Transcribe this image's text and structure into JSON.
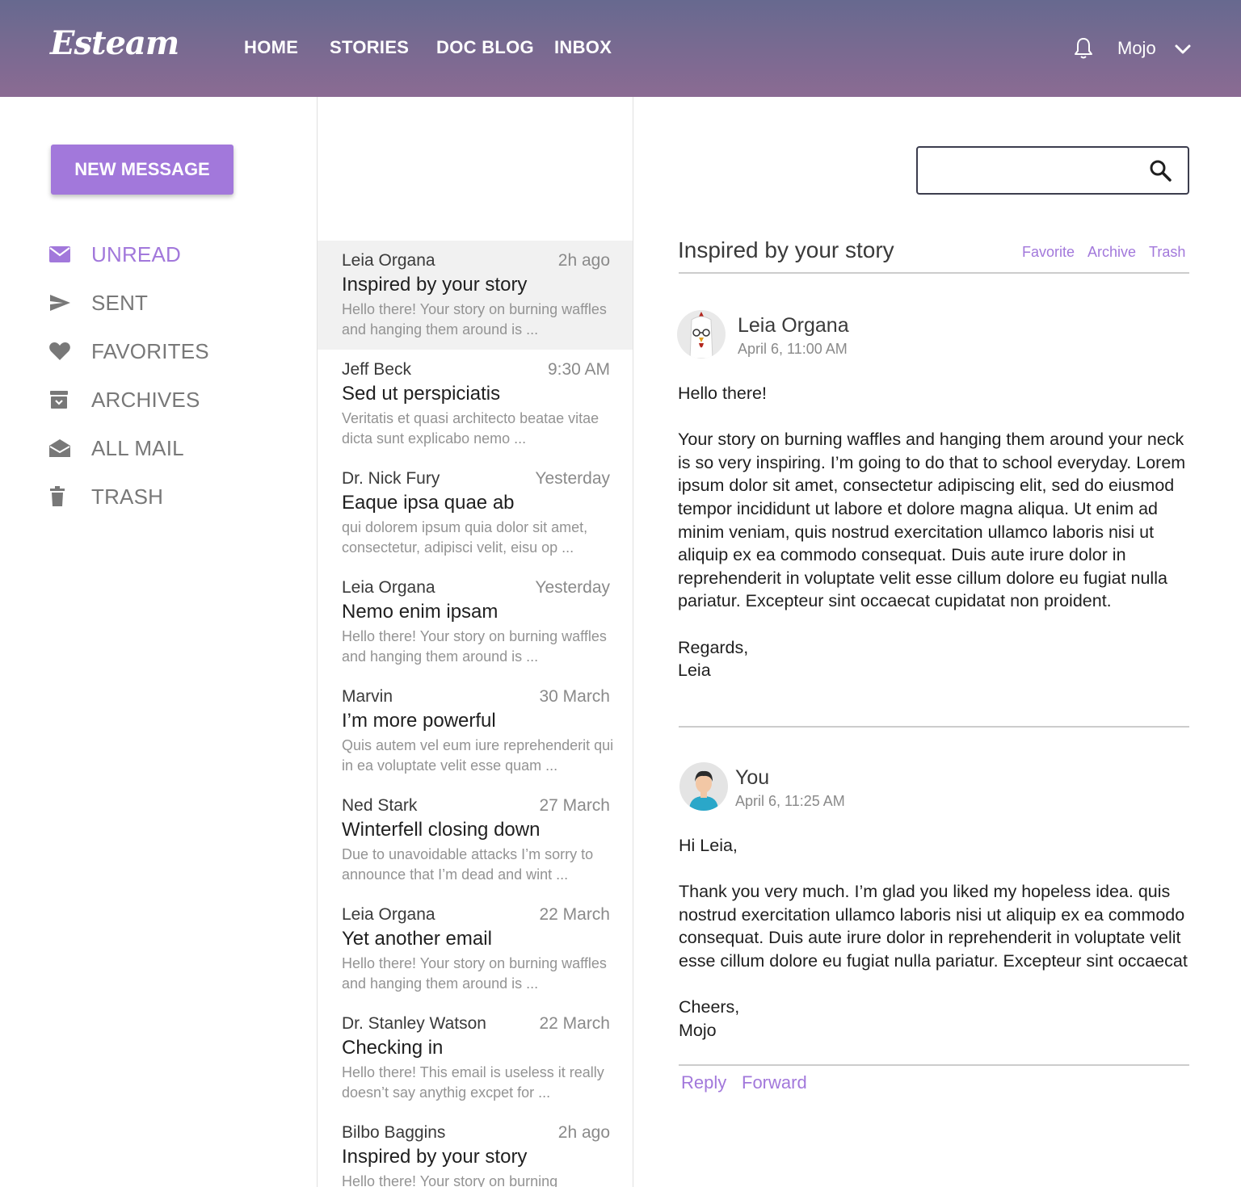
{
  "brand": {
    "logo": "Esteam"
  },
  "nav": {
    "items": [
      {
        "label": "HOME"
      },
      {
        "label": "STORIES"
      },
      {
        "label": "DOC BLOG"
      },
      {
        "label": "INBOX"
      }
    ]
  },
  "user": {
    "name": "Mojo"
  },
  "sidebar": {
    "new_message_label": "NEW MESSAGE",
    "folders": [
      {
        "label": "UNREAD",
        "icon": "envelope-icon",
        "active": true
      },
      {
        "label": "SENT",
        "icon": "send-icon"
      },
      {
        "label": "FAVORITES",
        "icon": "heart-icon"
      },
      {
        "label": "ARCHIVES",
        "icon": "archive-icon"
      },
      {
        "label": "ALL MAIL",
        "icon": "open-envelope-icon"
      },
      {
        "label": "TRASH",
        "icon": "trash-icon"
      }
    ]
  },
  "messages": [
    {
      "from": "Leia Organa",
      "time": "2h ago",
      "subject": "Inspired by your story",
      "preview": "Hello there! Your story on burning waffles and hanging them around is ...",
      "selected": true
    },
    {
      "from": "Jeff Beck",
      "time": "9:30 AM",
      "subject": "Sed ut perspiciatis",
      "preview": "Veritatis et quasi architecto beatae vitae dicta sunt explicabo nemo ..."
    },
    {
      "from": "Dr. Nick Fury",
      "time": "Yesterday",
      "subject": "Eaque ipsa quae ab",
      "preview": "qui dolorem ipsum quia dolor sit amet, consectetur, adipisci velit, eisu op ..."
    },
    {
      "from": "Leia Organa",
      "time": "Yesterday",
      "subject": "Nemo enim ipsam",
      "preview": "Hello there! Your story on burning waffles and hanging them around is ..."
    },
    {
      "from": "Marvin",
      "time": "30 March",
      "subject": "I’m more powerful",
      "preview": "Quis autem vel eum iure reprehenderit qui in ea voluptate velit esse quam ..."
    },
    {
      "from": "Ned Stark",
      "time": "27 March",
      "subject": "Winterfell closing down",
      "preview": "Due to unavoidable attacks I’m sorry to announce that I’m dead and wint  ..."
    },
    {
      "from": "Leia Organa",
      "time": "22 March",
      "subject": "Yet another email",
      "preview": "Hello there! Your story on burning waffles and hanging them around is ..."
    },
    {
      "from": "Dr. Stanley Watson",
      "time": "22 March",
      "subject": "Checking in",
      "preview": "Hello there! This email is useless it really doesn’t say anythig excpet for  ..."
    },
    {
      "from": "Bilbo Baggins",
      "time": "2h ago",
      "subject": "Inspired by your story",
      "preview": "Hello there! Your story on burning"
    }
  ],
  "search": {
    "placeholder": "",
    "value": ""
  },
  "thread": {
    "title": "Inspired by your story",
    "actions": {
      "favorite": "Favorite",
      "archive": "Archive",
      "trash": "Trash"
    },
    "emails": [
      {
        "sender": "Leia Organa",
        "date": "April 6, 11:00 AM",
        "greeting": "Hello there!",
        "body": "Your story on burning waffles and hanging them around your neck is so very inspiring. I’m going to do that to school everyday. Lorem ipsum dolor sit amet, consectetur adipiscing elit, sed do eiusmod tempor incididunt ut labore et dolore magna aliqua. Ut enim ad minim veniam, quis nostrud exercitation ullamco laboris nisi ut aliquip ex ea commodo consequat. Duis aute irure dolor in reprehenderit in voluptate velit esse cillum dolore eu fugiat nulla pariatur. Excepteur sint occaecat cupidatat non proident.",
        "signoff": "Regards,",
        "signature": "Leia"
      },
      {
        "sender": "You",
        "date": "April 6, 11:25 AM",
        "greeting": "Hi Leia,",
        "body": "Thank you very much. I’m glad you liked my hopeless idea. quis nostrud exercitation ullamco laboris nisi ut aliquip ex ea commodo consequat. Duis aute irure dolor in reprehenderit in voluptate velit esse cillum dolore eu fugiat nulla pariatur. Excepteur sint occaecat",
        "signoff": "Cheers,",
        "signature": "Mojo"
      }
    ],
    "reply_label": "Reply",
    "forward_label": "Forward"
  },
  "colors": {
    "accent": "#a278db",
    "header_top": "#67698f",
    "header_bottom": "#8b6b93",
    "selected_row": "#f1f1f1"
  }
}
